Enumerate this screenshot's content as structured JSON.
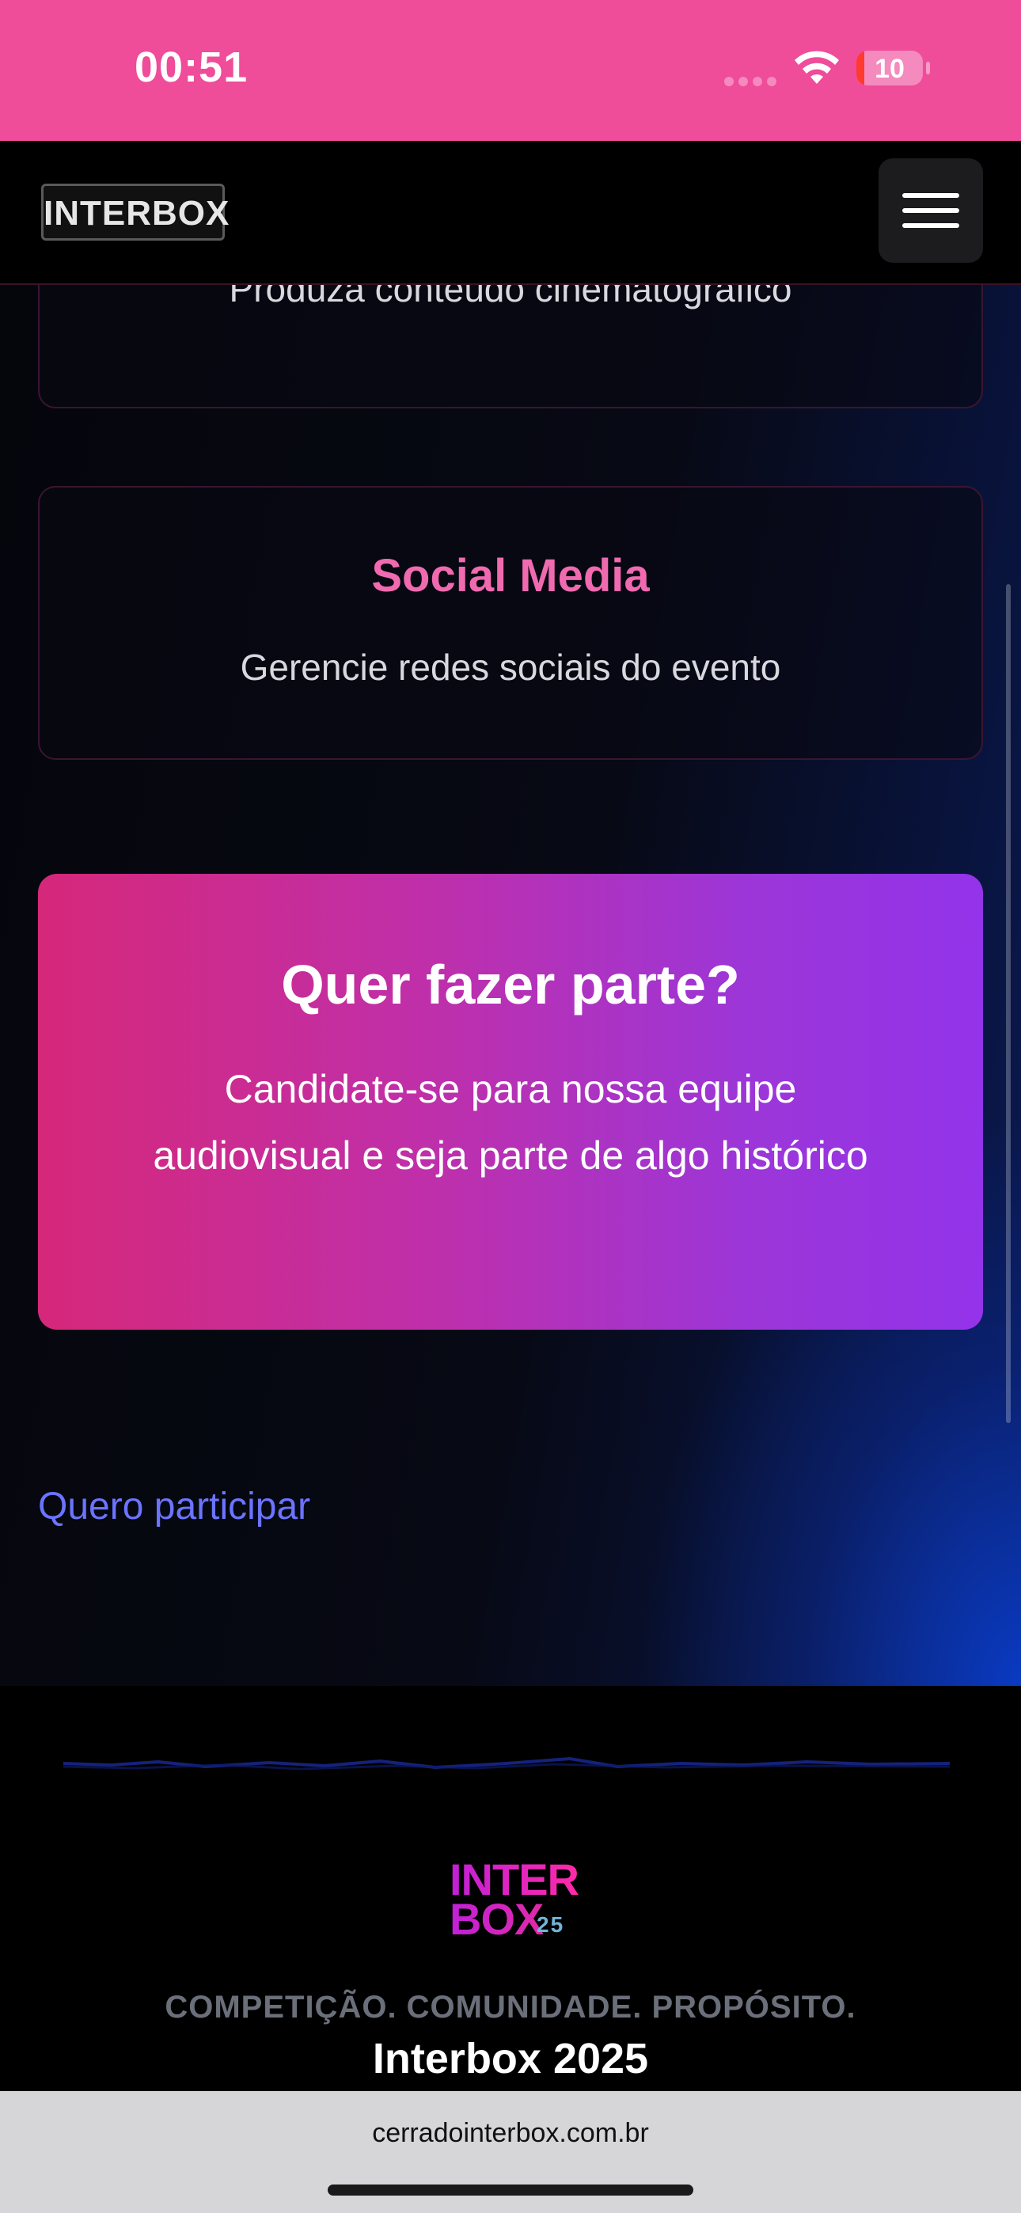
{
  "status_bar": {
    "time": "00:51",
    "battery": "10"
  },
  "header": {
    "logo_text": "INTERBOX",
    "menu_icon": "hamburger-menu-icon"
  },
  "cards": [
    {
      "description": "Produza conteúdo cinematográfico"
    },
    {
      "title": "Social Media",
      "description": "Gerencie redes sociais do evento"
    }
  ],
  "cta": {
    "title": "Quer fazer parte?",
    "description": "Candidate-se para nossa equipe audiovisual e seja parte de algo histórico"
  },
  "link": {
    "label": "Quero participar"
  },
  "footer": {
    "logo_line1": "INTER",
    "logo_line2": "BOX",
    "logo_year": "25",
    "tagline": "COMPETIÇÃO. COMUNIDADE. PROPÓSITO.",
    "title": "Interbox 2025"
  },
  "browser": {
    "url": "cerradointerbox.com.br"
  },
  "colors": {
    "status_bar": "#ef4c9a",
    "accent_pink": "#f06ab0",
    "link_blue": "#6b74ff",
    "cta_start": "#d6287a",
    "cta_end": "#9333ea"
  }
}
